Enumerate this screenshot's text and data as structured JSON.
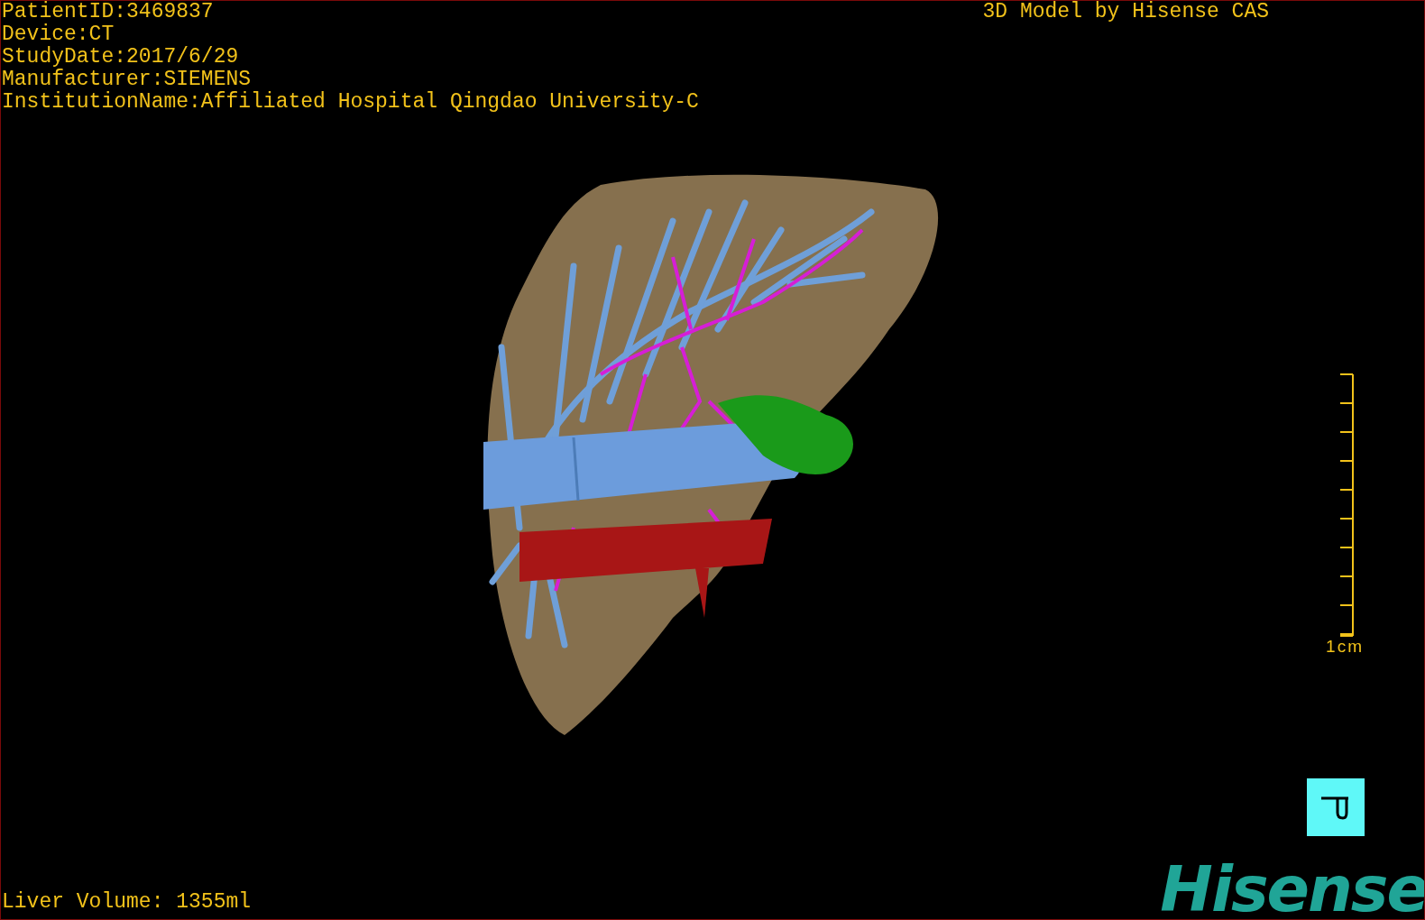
{
  "info_lines": [
    "PatientID:3469837",
    "Device:CT",
    "StudyDate:2017/6/29",
    "Manufacturer:SIEMENS",
    "InstitutionName:Affiliated Hospital Qingdao University-C"
  ],
  "title": "3D Model by Hisense CAS",
  "scale": {
    "label": "1cm"
  },
  "liver_volume": "Liver Volume: 1355ml",
  "logo": "Hisense"
}
